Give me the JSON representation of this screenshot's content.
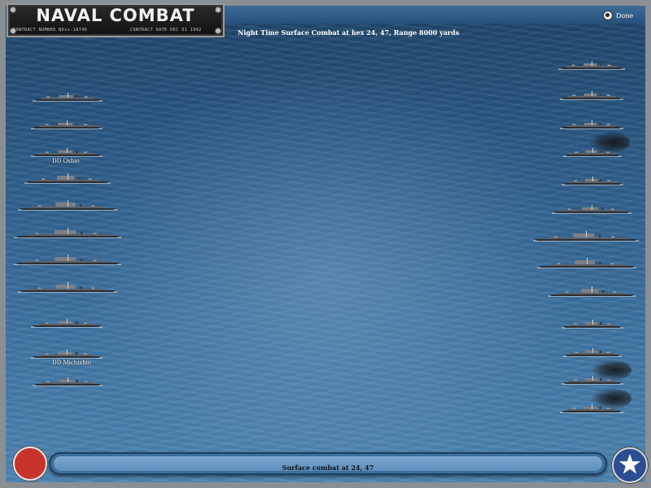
{
  "title": {
    "main": "NAVAL COMBAT",
    "left_sub": "CONTRACT NUMBER  NXss-18746",
    "right_sub": "CONTRACT DATE  DEC 31 1942"
  },
  "done_label": "Done",
  "combat_header": "Night Time Surface Combat at hex 24, 47, Range 8000 yards",
  "status_message": "Surface combat at 24, 47",
  "colors": {
    "sea": "#2b5a86",
    "japan_red": "#c8332b",
    "us_blue": "#2b4d93"
  },
  "japanese_ships": [
    {
      "name": ""
    },
    {
      "name": ""
    },
    {
      "name": "DD Oshio"
    },
    {
      "name": ""
    },
    {
      "name": ""
    },
    {
      "name": ""
    },
    {
      "name": ""
    },
    {
      "name": ""
    },
    {
      "name": ""
    },
    {
      "name": "DD Michishio"
    },
    {
      "name": ""
    }
  ],
  "allied_ships": [
    {
      "name": ""
    },
    {
      "name": ""
    },
    {
      "name": ""
    },
    {
      "name": ""
    },
    {
      "name": ""
    },
    {
      "name": ""
    },
    {
      "name": ""
    },
    {
      "name": ""
    },
    {
      "name": ""
    },
    {
      "name": ""
    },
    {
      "name": ""
    },
    {
      "name": ""
    },
    {
      "name": ""
    }
  ],
  "icons": {
    "done": "radio-button-icon",
    "japan": "rising-sun-roundel-icon",
    "us": "white-star-roundel-icon"
  }
}
